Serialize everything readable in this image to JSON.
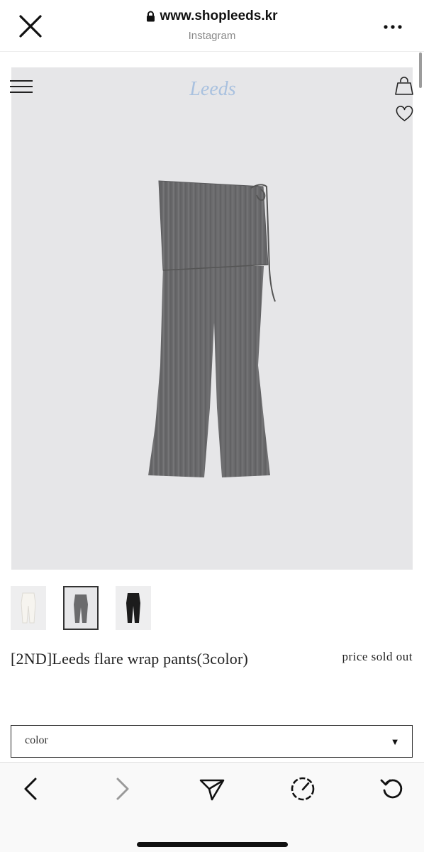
{
  "browser": {
    "url": "www.shopleeds.kr",
    "source": "Instagram",
    "icons": {
      "close": "close-icon",
      "lock": "lock-icon",
      "more": "more-dots-icon"
    }
  },
  "header": {
    "logo_text": "Leeds",
    "icons": [
      "hamburger-menu-icon",
      "shopping-bag-icon",
      "heart-icon"
    ]
  },
  "product": {
    "image": "grey ribbed flare wrap pants",
    "thumbnails": [
      {
        "color": "ivory",
        "selected": false
      },
      {
        "color": "grey",
        "selected": true
      },
      {
        "color": "black",
        "selected": false
      }
    ],
    "title": "[2ND]Leeds flare wrap pants(3color)",
    "price": "price sold out"
  },
  "options": {
    "color_select": {
      "label": "color",
      "caret": "▼"
    }
  },
  "toolbar": {
    "icons": [
      "back-arrow-icon",
      "forward-arrow-icon",
      "share-send-icon",
      "speed-gauge-icon",
      "reload-icon"
    ]
  },
  "colors": {
    "hero_bg": "#e6e6e8",
    "pants_grey": "#6b6b6d",
    "logo_blue": "#a9c1df",
    "forward_disabled": "#9a9a9a"
  }
}
